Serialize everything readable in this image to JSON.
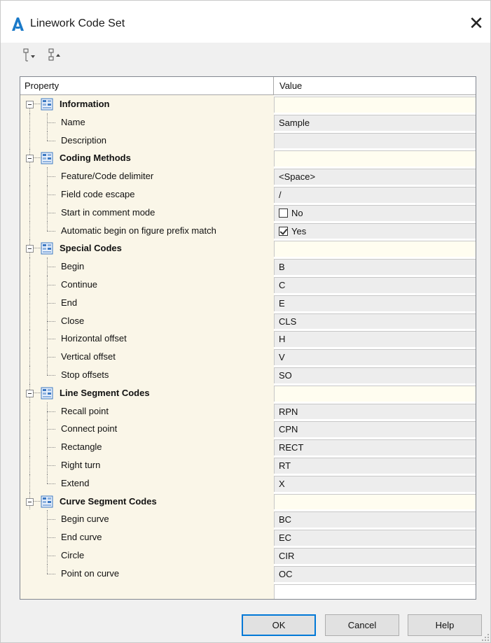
{
  "window": {
    "title": "Linework Code Set",
    "close_glyph": "✕"
  },
  "toolbar": {
    "buttons": [
      {
        "icon": "expand-all-icon"
      },
      {
        "icon": "collapse-all-icon"
      }
    ]
  },
  "grid": {
    "header": {
      "property": "Property",
      "value": "Value"
    },
    "categories": [
      {
        "label": "Information",
        "rows": [
          {
            "label": "Name",
            "value": "Sample"
          },
          {
            "label": "Description",
            "value": ""
          }
        ]
      },
      {
        "label": "Coding Methods",
        "rows": [
          {
            "label": "Feature/Code delimiter",
            "value": "<Space>"
          },
          {
            "label": "Field code escape",
            "value": "/"
          },
          {
            "label": "Start in comment mode",
            "value": "No",
            "checkbox": false
          },
          {
            "label": "Automatic begin on figure prefix match",
            "value": "Yes",
            "checkbox": true
          }
        ]
      },
      {
        "label": "Special Codes",
        "rows": [
          {
            "label": "Begin",
            "value": "B"
          },
          {
            "label": "Continue",
            "value": "C"
          },
          {
            "label": "End",
            "value": "E"
          },
          {
            "label": "Close",
            "value": "CLS"
          },
          {
            "label": "Horizontal offset",
            "value": "H"
          },
          {
            "label": "Vertical offset",
            "value": "V"
          },
          {
            "label": "Stop offsets",
            "value": "SO"
          }
        ]
      },
      {
        "label": "Line Segment Codes",
        "rows": [
          {
            "label": "Recall point",
            "value": "RPN"
          },
          {
            "label": "Connect point",
            "value": "CPN"
          },
          {
            "label": "Rectangle",
            "value": "RECT"
          },
          {
            "label": "Right turn",
            "value": "RT"
          },
          {
            "label": "Extend",
            "value": "X"
          }
        ]
      },
      {
        "label": "Curve Segment Codes",
        "rows": [
          {
            "label": "Begin curve",
            "value": "BC"
          },
          {
            "label": "End curve",
            "value": "EC"
          },
          {
            "label": "Circle",
            "value": "CIR"
          },
          {
            "label": "Point on curve",
            "value": "OC"
          }
        ]
      }
    ]
  },
  "footer": {
    "ok_label": "OK",
    "cancel_label": "Cancel",
    "help_label": "Help"
  },
  "colors": {
    "accent": "#0078d7",
    "app_icon": "#1b7ac9",
    "category_icon": "#3b78c2",
    "property_column_bg": "#faf6e8"
  }
}
